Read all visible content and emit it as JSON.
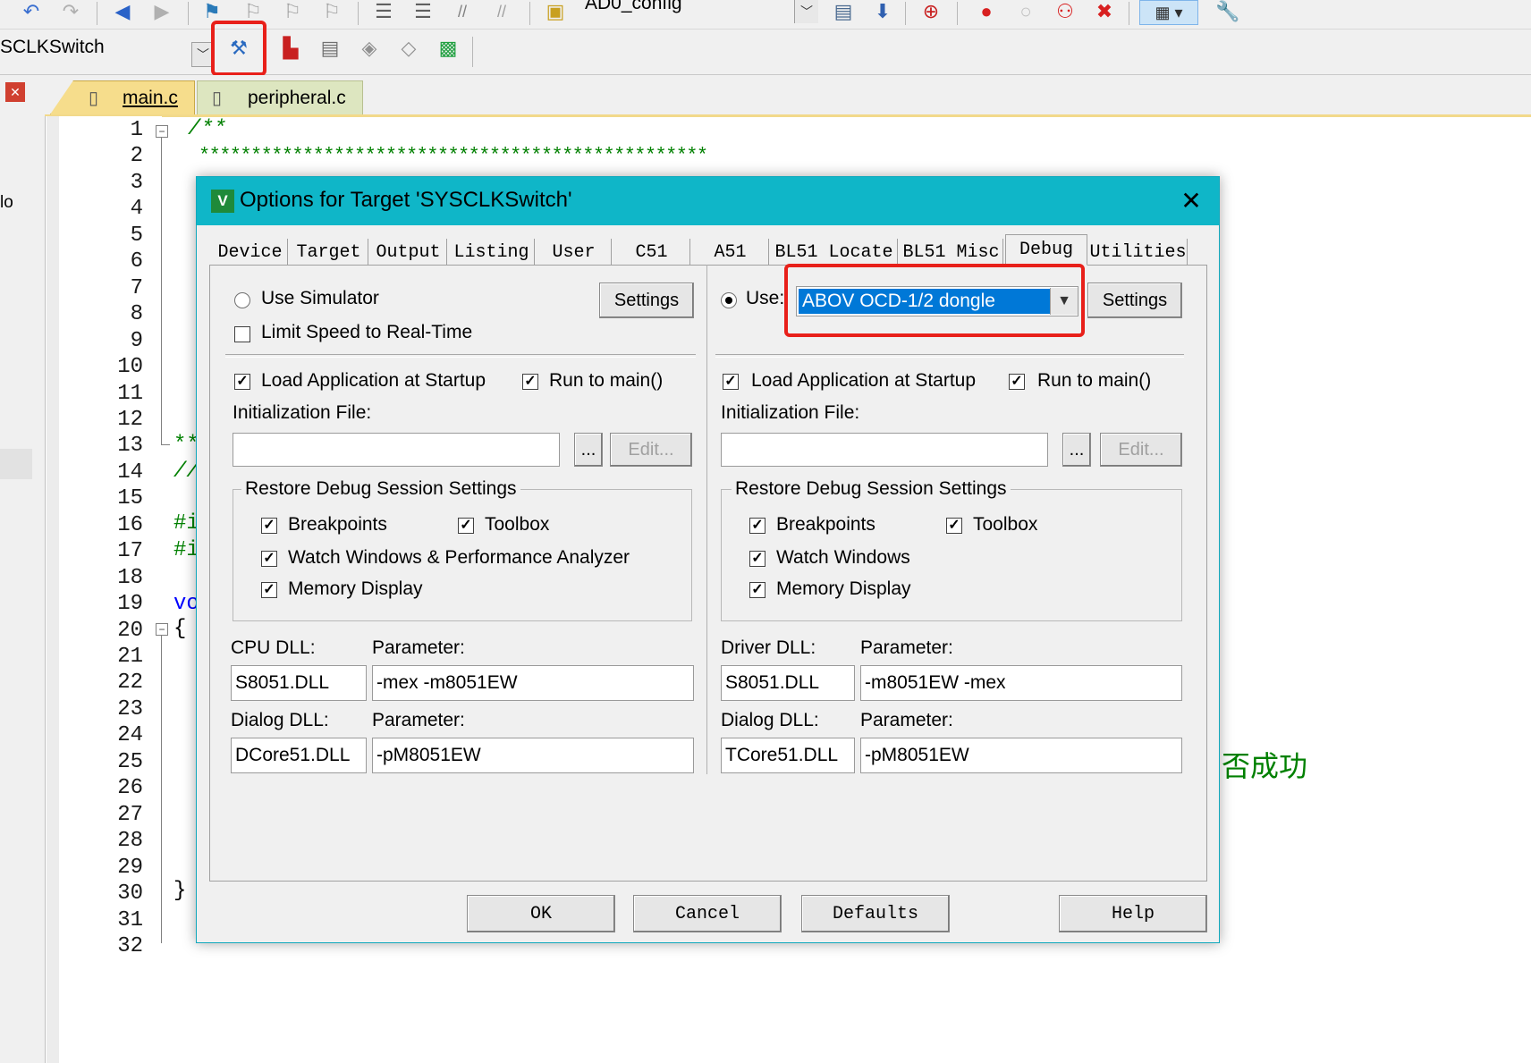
{
  "toolbar": {
    "target_combo": "AD0_config",
    "project_combo": "SCLKSwitch"
  },
  "editor": {
    "tabs": [
      {
        "label": "main.c",
        "active": true
      },
      {
        "label": "peripheral.c",
        "active": false
      }
    ],
    "left_panel_fragment": "lo",
    "line_numbers": [
      "1",
      "2",
      "3",
      "4",
      "5",
      "6",
      "7",
      "8",
      "9",
      "10",
      "11",
      "12",
      "13",
      "14",
      "15",
      "16",
      "17",
      "18",
      "19",
      "20",
      "21",
      "22",
      "23",
      "24",
      "25",
      "26",
      "27",
      "28",
      "29",
      "30",
      "31",
      "32"
    ],
    "code": {
      "l1": "/**",
      "l2": "*************************************************",
      "l13": "**",
      "l14": "//",
      "l16": "#i",
      "l17": "#i",
      "l19": "vo",
      "l20": "{",
      "l30": "}",
      "comment_right": "否成功"
    },
    "colors": {
      "comment": "#008000",
      "keyword": "#0000ff",
      "tab_accent": "#f2d98a"
    }
  },
  "dialog": {
    "title": "Options for Target 'SYSCLKSwitch'",
    "close_glyph": "✕",
    "tabs": [
      "Device",
      "Target",
      "Output",
      "Listing",
      "User",
      "C51",
      "A51",
      "BL51 Locate",
      "BL51 Misc",
      "Debug",
      "Utilities"
    ],
    "active_tab": "Debug",
    "left": {
      "use_simulator": "Use Simulator",
      "use_simulator_checked": false,
      "settings_button": "Settings",
      "limit_speed": "Limit Speed to Real-Time",
      "limit_speed_checked": false,
      "load_app": "Load Application at Startup",
      "run_to_main": "Run to main()",
      "init_file_label": "Initialization File:",
      "init_file_value": "",
      "browse_button": "...",
      "edit_button": "Edit...",
      "restore_group": "Restore Debug Session Settings",
      "breakpoints": "Breakpoints",
      "toolbox": "Toolbox",
      "watch_windows": "Watch Windows & Performance Analyzer",
      "memory_display": "Memory Display",
      "cpu_dll_label": "CPU DLL:",
      "cpu_param_label": "Parameter:",
      "cpu_dll": "S8051.DLL",
      "cpu_param": "-mex -m8051EW",
      "dialog_dll_label": "Dialog DLL:",
      "dialog_param_label": "Parameter:",
      "dialog_dll": "DCore51.DLL",
      "dialog_param": "-pM8051EW"
    },
    "right": {
      "use_label": "Use:",
      "use_checked": true,
      "driver_selected": "ABOV OCD-1/2 dongle",
      "settings_button": "Settings",
      "load_app": "Load Application at Startup",
      "run_to_main": "Run to main()",
      "init_file_label": "Initialization File:",
      "init_file_value": "",
      "browse_button": "...",
      "edit_button": "Edit...",
      "restore_group": "Restore Debug Session Settings",
      "breakpoints": "Breakpoints",
      "toolbox": "Toolbox",
      "watch_windows": "Watch Windows",
      "memory_display": "Memory Display",
      "driver_dll_label": "Driver DLL:",
      "driver_param_label": "Parameter:",
      "driver_dll": "S8051.DLL",
      "driver_param": "-m8051EW -mex",
      "dialog_dll_label": "Dialog DLL:",
      "dialog_param_label": "Parameter:",
      "dialog_dll": "TCore51.DLL",
      "dialog_param": "-pM8051EW"
    },
    "buttons": {
      "ok": "OK",
      "cancel": "Cancel",
      "defaults": "Defaults",
      "help": "Help"
    },
    "colors": {
      "title_bar": "#0fb6c8",
      "selection": "#0078d7",
      "highlight_box": "#e8201a"
    }
  }
}
